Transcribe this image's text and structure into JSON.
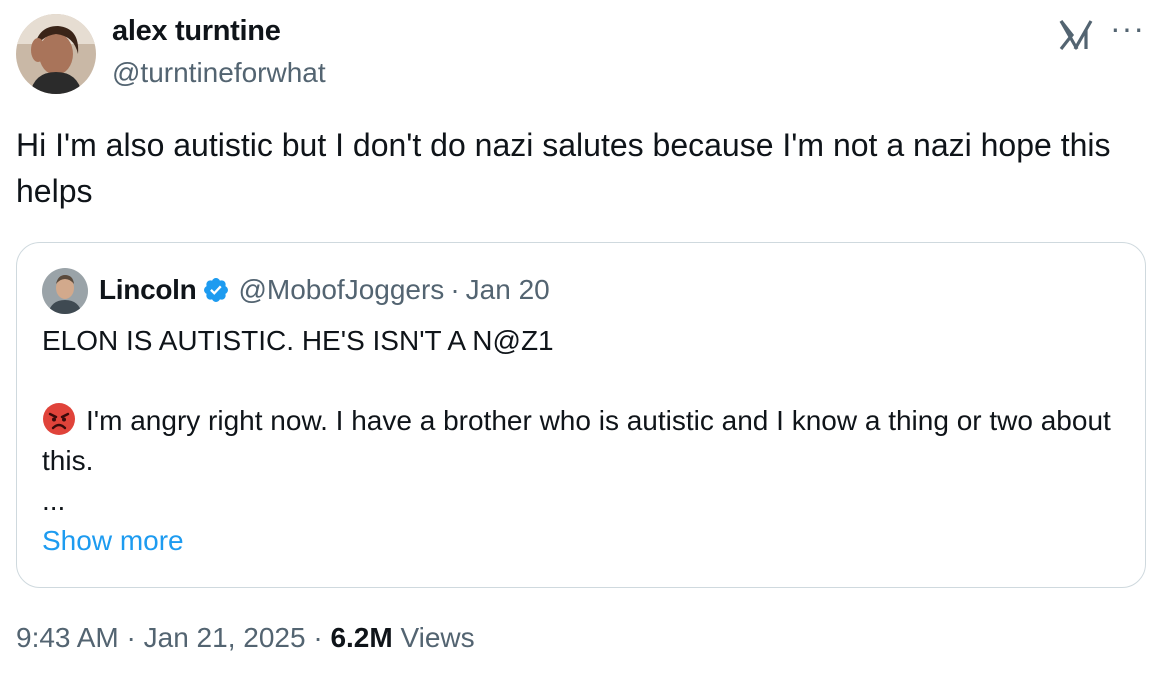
{
  "tweet": {
    "author": {
      "name": "alex turntine",
      "handle": "@turntineforwhat"
    },
    "text": "Hi I'm also autistic but I don't do nazi salutes because I'm not a nazi hope this helps",
    "more_icon": "ellipsis-icon",
    "logo_icon": "x-logo-icon"
  },
  "quote": {
    "author": {
      "name": "Lincoln",
      "handle": "@MobofJoggers",
      "separator": "·",
      "date": "Jan 20"
    },
    "verified_icon": "verified-badge-icon",
    "line1": "ELON IS AUTISTIC. HE'S ISN'T A N@Z1",
    "emoji_icon": "angry-face-icon",
    "line2": "I'm angry right now. I have a brother who is autistic and I know a thing or two about this.",
    "ellipsis": "...",
    "show_more": "Show more"
  },
  "footer": {
    "time": "9:43 AM",
    "sep1": "·",
    "date": "Jan 21, 2025",
    "sep2": "·",
    "views_count": "6.2M",
    "views_label": "Views"
  },
  "colors": {
    "text": "#0f1419",
    "secondary": "#536471",
    "link": "#1d9bf0",
    "border": "#cfd9de",
    "verified": "#1d9bf0"
  }
}
